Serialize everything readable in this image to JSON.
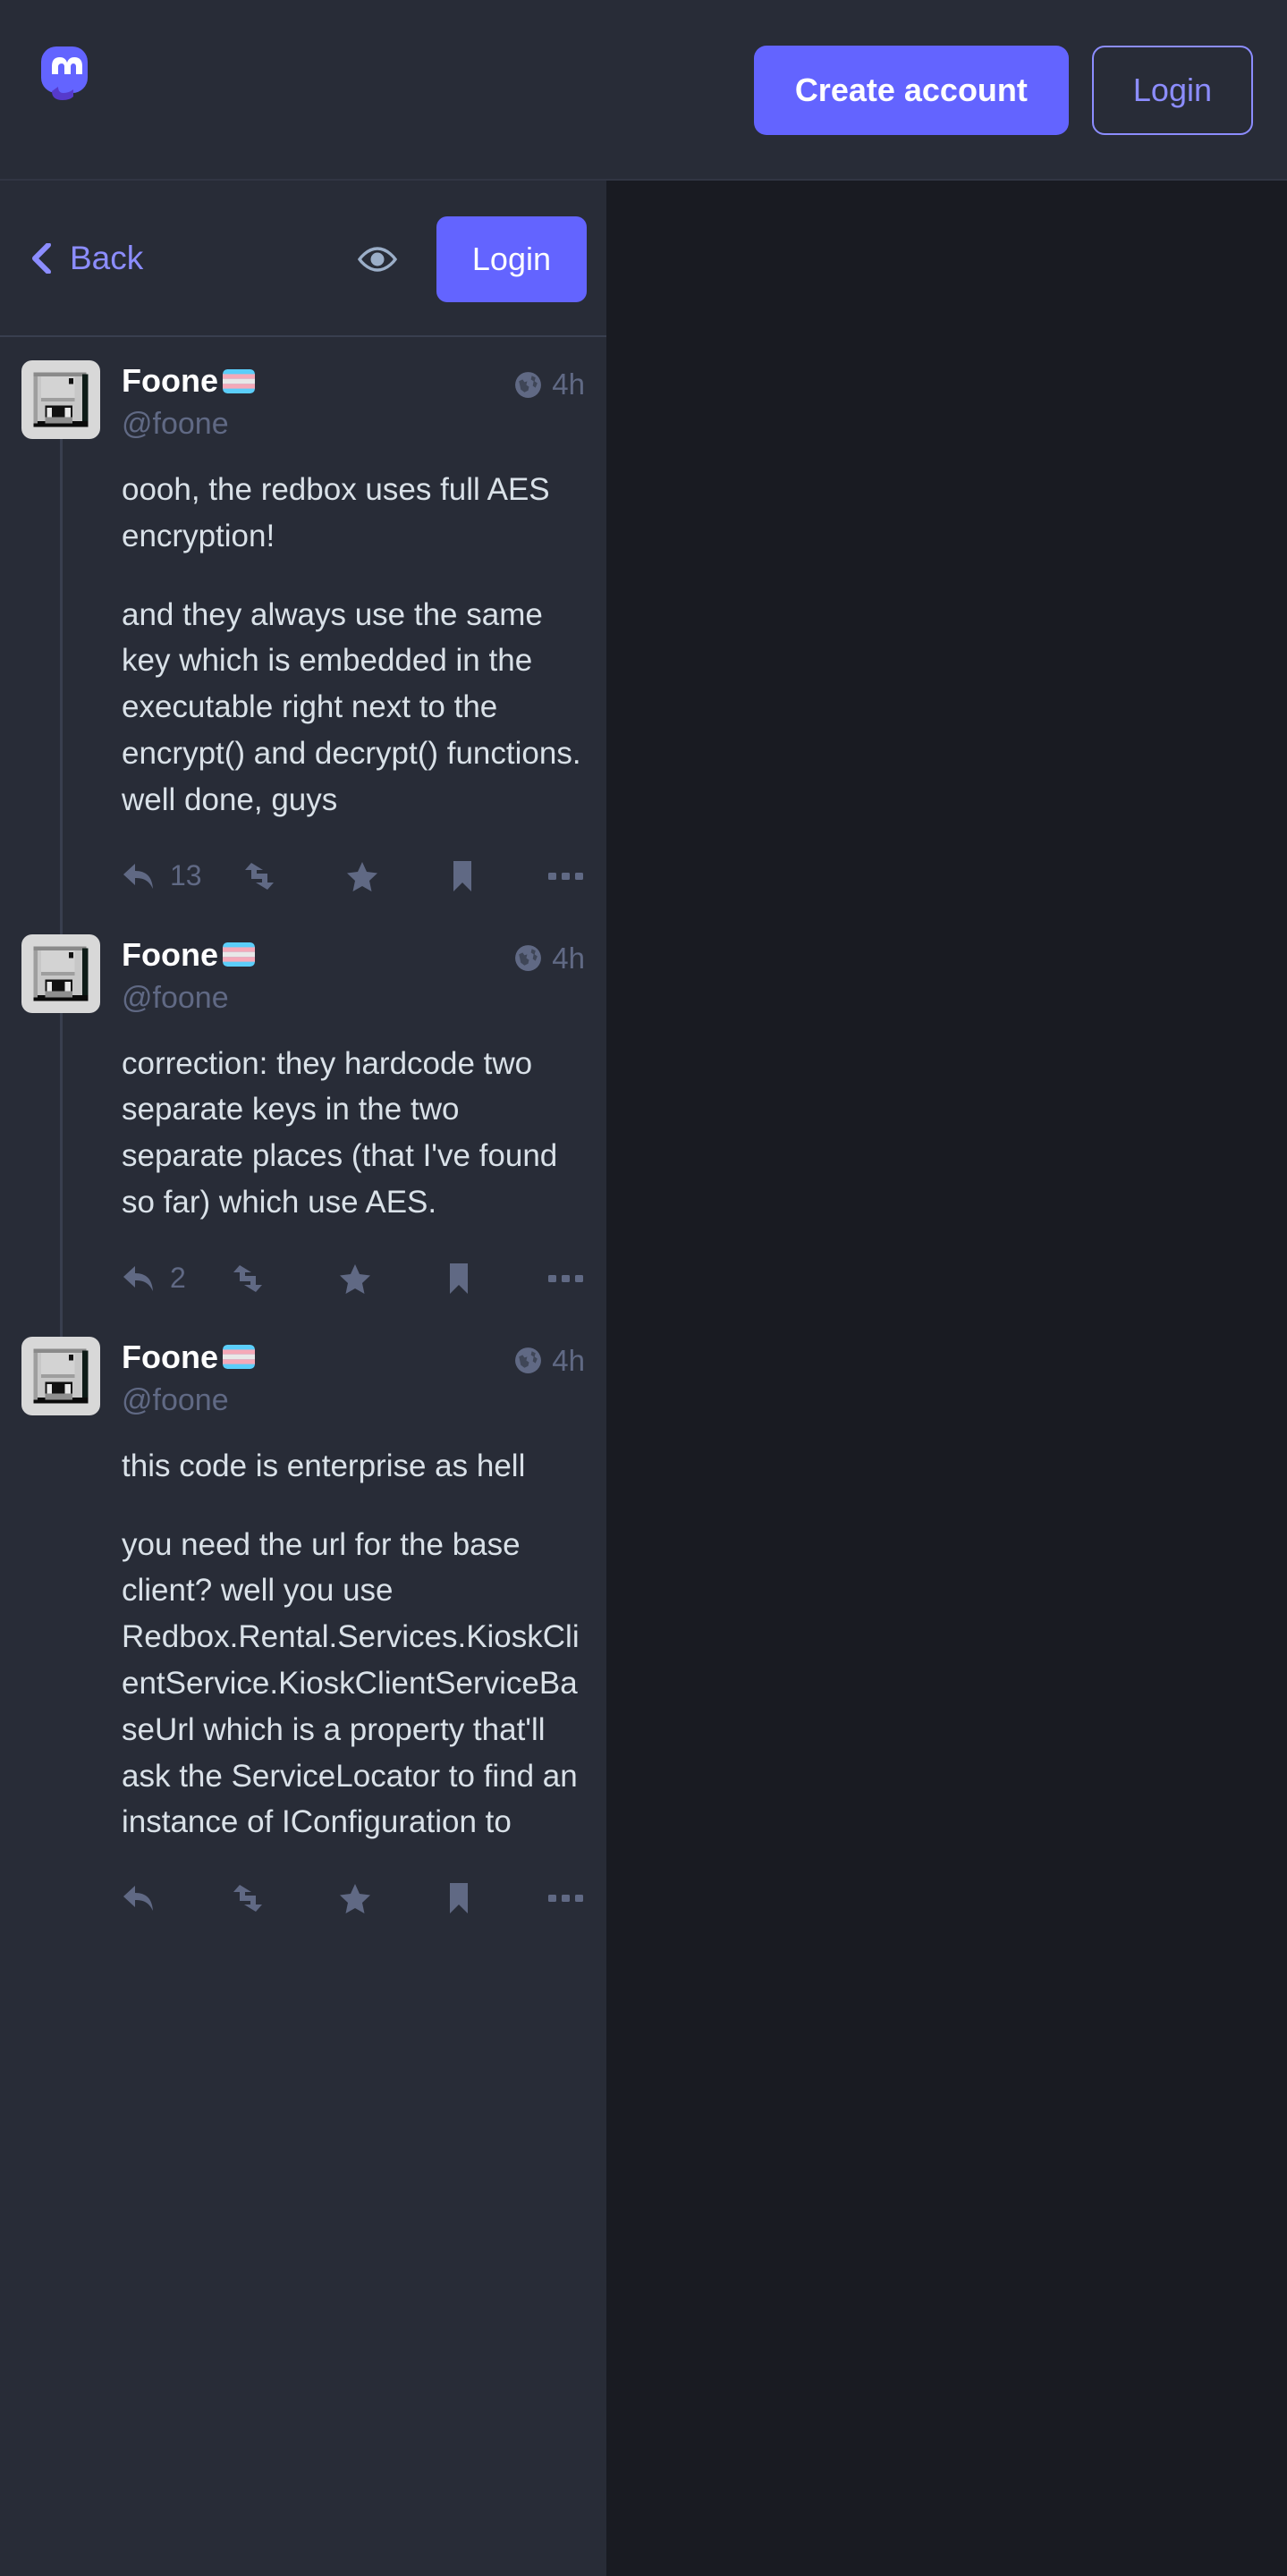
{
  "topbar": {
    "logo_name": "mastodon-logo",
    "create_account_label": "Create account",
    "login_label": "Login",
    "brand_color": "#6364ff",
    "outline_color": "#8c8dff"
  },
  "subheader": {
    "back_label": "Back",
    "eye_icon": "eye-icon",
    "login_label": "Login"
  },
  "thread": {
    "statuses": [
      {
        "avatar_icon": "floppy-disk-avatar",
        "display_name": "Foone",
        "flag_emoji": "transgender-flag",
        "acct": "@foone",
        "visibility_icon": "globe-icon",
        "timestamp": "4h",
        "paragraphs": [
          "oooh, the redbox uses full AES encryption!",
          "and they always use the same key which is embedded in the executable right next to the encrypt() and decrypt() functions. well done, guys"
        ],
        "actions": {
          "reply_count": "13",
          "boost_count": "",
          "favourite_count": "",
          "bookmark_count": "",
          "more_label": "•••"
        }
      },
      {
        "avatar_icon": "floppy-disk-avatar",
        "display_name": "Foone",
        "flag_emoji": "transgender-flag",
        "acct": "@foone",
        "visibility_icon": "globe-icon",
        "timestamp": "4h",
        "paragraphs": [
          "correction: they hardcode two separate keys in the two separate places (that I've found so far) which use AES."
        ],
        "actions": {
          "reply_count": "2",
          "boost_count": "",
          "favourite_count": "",
          "bookmark_count": "",
          "more_label": "•••"
        }
      },
      {
        "avatar_icon": "floppy-disk-avatar",
        "display_name": "Foone",
        "flag_emoji": "transgender-flag",
        "acct": "@foone",
        "visibility_icon": "globe-icon",
        "timestamp": "4h",
        "paragraphs": [
          "this code is enterprise as hell",
          "you need the url for the base client? well you use Redbox.Rental.Services.KioskClientService.KioskClientServiceBaseUrl which is a property that'll ask the ServiceLocator to find an instance of IConfiguration to"
        ],
        "actions": {
          "reply_count": "",
          "boost_count": "",
          "favourite_count": "",
          "bookmark_count": "",
          "more_label": "•••"
        }
      }
    ]
  },
  "colors": {
    "page_bg": "#191b22",
    "column_bg": "#282c37",
    "text_primary": "#d9e1e8",
    "text_muted": "#606984",
    "divider": "#393f4f"
  }
}
